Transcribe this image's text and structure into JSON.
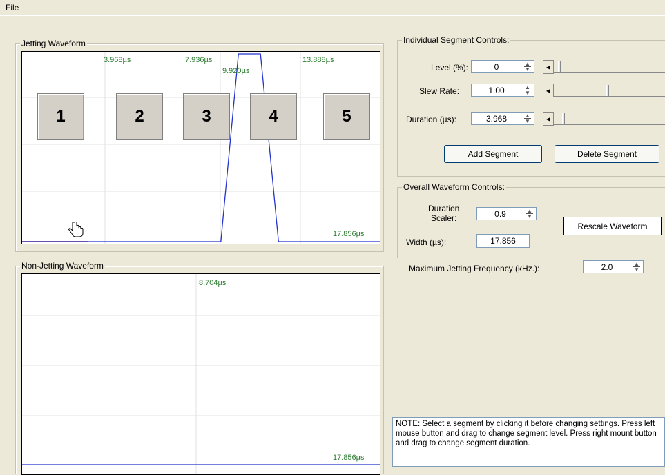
{
  "menu": {
    "file_label": "File"
  },
  "jetting": {
    "title": "Jetting Waveform",
    "time_labels": [
      "3.968µs",
      "7.936µs",
      "9.920µs",
      "13.888µs"
    ],
    "end_label": "17.856µs",
    "segments": [
      "1",
      "2",
      "3",
      "4",
      "5"
    ],
    "waveform_points_us": [
      [
        0,
        0
      ],
      [
        9.92,
        0
      ],
      [
        10.8,
        100
      ],
      [
        11.9,
        100
      ],
      [
        12.8,
        0
      ],
      [
        17.856,
        0
      ]
    ]
  },
  "nonjetting": {
    "title": "Non-Jetting Waveform",
    "mid_label": "8.704µs",
    "end_label": "17.856µs"
  },
  "segment_controls": {
    "title": "Individual Segment Controls:",
    "level_label": "Level (%):",
    "level_value": "0",
    "slew_label": "Slew Rate:",
    "slew_value": "1.00",
    "duration_label": "Duration (µs):",
    "duration_value": "3.968",
    "add_label": "Add Segment",
    "delete_label": "Delete Segment"
  },
  "overall_controls": {
    "title": "Overall Waveform Controls:",
    "scaler_label_line1": "Duration",
    "scaler_label_line2": "Scaler:",
    "scaler_value": "0.9",
    "width_label": "Width (µs):",
    "width_value": "17.856",
    "rescale_label": "Rescale Waveform"
  },
  "frequency": {
    "label": "Maximum Jetting Frequency (kHz.):",
    "value": "2.0"
  },
  "note_text": "NOTE: Select a segment by clicking it before changing settings.  Press left mouse button and drag to change segment level.  Press right mount button and drag to change segment duration.",
  "colors": {
    "waveform": "#2233cc",
    "baseline": "#cc0000",
    "time_label": "#2e7d32"
  }
}
